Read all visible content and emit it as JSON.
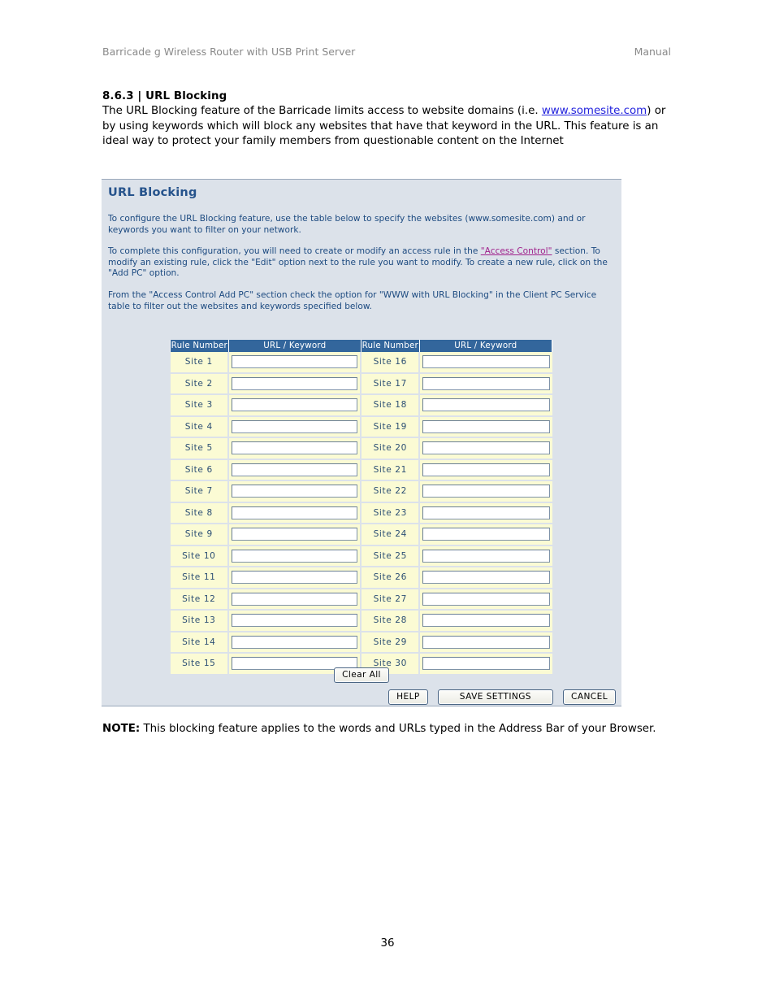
{
  "page": {
    "header_left": "Barricade g Wireless Router with USB Print Server",
    "header_right": "Manual",
    "page_number": "36"
  },
  "section": {
    "title": "8.6.3 | URL Blocking",
    "body_part1": "The URL Blocking feature of the Barricade limits access to website domains (i.e. ",
    "body_link": "www.somesite.com",
    "body_part2": ") or by using keywords which will block any websites that have that keyword in the URL. This feature is an ideal way to protect your family members from questionable content on the Internet"
  },
  "panel": {
    "title": "URL Blocking",
    "paragraph1": "To configure the URL Blocking feature, use the table below to specify the websites (www.somesite.com) and or keywords you want to filter on your network.",
    "paragraph2_part1": "To complete this configuration, you will need to create or modify an access rule in the ",
    "paragraph2_link": "\"Access Control\"",
    "paragraph2_part2": " section. To modify an existing rule, click the \"Edit\" option next to the rule you want to modify. To create a new rule, click on the \"Add PC\" option.",
    "paragraph3": "From the \"Access Control Add PC\" section check the option for \"WWW with URL Blocking\" in the Client PC Service table to filter out the websites and keywords specified below.",
    "colors": {
      "panel_background": "#dce2ea",
      "title_text": "#26538c",
      "body_text": "#1c4a80",
      "link_text": "#a0228c",
      "table_header_bg": "#33669c",
      "row_label_bg": "#fbfbd4",
      "row_label_text": "#2c4f74"
    }
  },
  "table": {
    "headers": [
      "Rule Number",
      "URL / Keyword",
      "Rule Number",
      "URL / Keyword"
    ],
    "rows": [
      {
        "left_label": "Site  1",
        "left_value": "",
        "right_label": "Site  16",
        "right_value": ""
      },
      {
        "left_label": "Site  2",
        "left_value": "",
        "right_label": "Site  17",
        "right_value": ""
      },
      {
        "left_label": "Site  3",
        "left_value": "",
        "right_label": "Site  18",
        "right_value": ""
      },
      {
        "left_label": "Site  4",
        "left_value": "",
        "right_label": "Site  19",
        "right_value": ""
      },
      {
        "left_label": "Site  5",
        "left_value": "",
        "right_label": "Site  20",
        "right_value": ""
      },
      {
        "left_label": "Site  6",
        "left_value": "",
        "right_label": "Site  21",
        "right_value": ""
      },
      {
        "left_label": "Site  7",
        "left_value": "",
        "right_label": "Site  22",
        "right_value": ""
      },
      {
        "left_label": "Site  8",
        "left_value": "",
        "right_label": "Site  23",
        "right_value": ""
      },
      {
        "left_label": "Site  9",
        "left_value": "",
        "right_label": "Site  24",
        "right_value": ""
      },
      {
        "left_label": "Site  10",
        "left_value": "",
        "right_label": "Site  25",
        "right_value": ""
      },
      {
        "left_label": "Site  11",
        "left_value": "",
        "right_label": "Site  26",
        "right_value": ""
      },
      {
        "left_label": "Site  12",
        "left_value": "",
        "right_label": "Site  27",
        "right_value": ""
      },
      {
        "left_label": "Site  13",
        "left_value": "",
        "right_label": "Site  28",
        "right_value": ""
      },
      {
        "left_label": "Site  14",
        "left_value": "",
        "right_label": "Site  29",
        "right_value": ""
      },
      {
        "left_label": "Site  15",
        "left_value": "",
        "right_label": "Site  30",
        "right_value": ""
      }
    ]
  },
  "buttons": {
    "clear_all": "Clear All",
    "help": "HELP",
    "save_settings": "SAVE SETTINGS",
    "cancel": "CANCEL"
  },
  "note": {
    "label": "NOTE:",
    "text": " This blocking feature applies to the words and URLs typed in the Address Bar of your Browser."
  }
}
